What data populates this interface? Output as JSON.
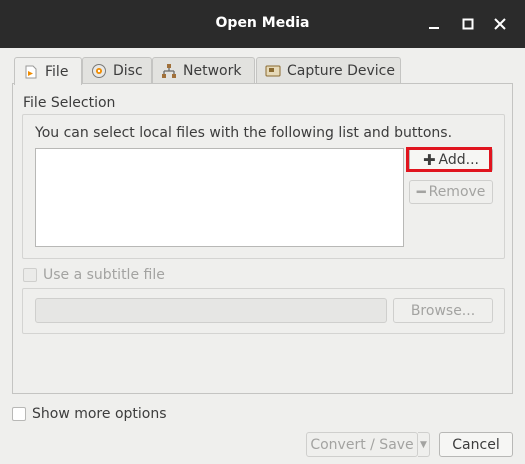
{
  "window": {
    "title": "Open Media"
  },
  "tabs": [
    {
      "label": "File",
      "icon": "file-icon"
    },
    {
      "label": "Disc",
      "icon": "disc-icon"
    },
    {
      "label": "Network",
      "icon": "network-icon"
    },
    {
      "label": "Capture Device",
      "icon": "capture-device-icon"
    }
  ],
  "file_selection": {
    "title": "File Selection",
    "help_text": "You can select local files with the following list and buttons.",
    "add_label": "Add...",
    "remove_label": "Remove"
  },
  "subtitle": {
    "checkbox_label": "Use a subtitle file",
    "browse_label": "Browse..."
  },
  "footer": {
    "show_more_label": "Show more options",
    "convert_label": "Convert / Save",
    "cancel_label": "Cancel"
  },
  "colors": {
    "highlight": "#e0141e",
    "titlebar": "#2b2b2b"
  }
}
